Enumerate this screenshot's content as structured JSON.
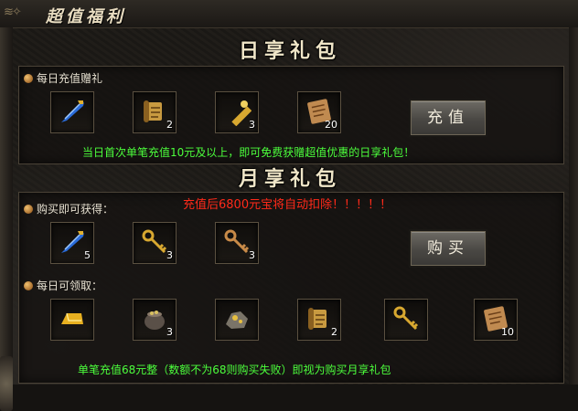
{
  "window": {
    "title": "超值福利"
  },
  "daily": {
    "title": "日享礼包",
    "subtitle": "每日充值赠礼",
    "items": [
      {
        "name": "feather-icon",
        "count": ""
      },
      {
        "name": "scroll-icon",
        "count": "2"
      },
      {
        "name": "telescope-icon",
        "count": "3"
      },
      {
        "name": "parchment-icon",
        "count": "20"
      }
    ],
    "button_label": "充值",
    "note": "当日首次单笔充值10元及以上，即可免费获赠超值优惠的日享礼包！"
  },
  "monthly": {
    "title": "月享礼包",
    "buy_label": "购买即可获得：",
    "warning": "充值后6800元宝将自动扣除！！！！！",
    "buy_items": [
      {
        "name": "feather-icon",
        "count": "5"
      },
      {
        "name": "key-icon",
        "count": "3"
      },
      {
        "name": "key-icon",
        "count": "3"
      }
    ],
    "button_label": "购买",
    "daily_label": "每日可领取：",
    "daily_items": [
      {
        "name": "gold-bar-icon",
        "count": ""
      },
      {
        "name": "pot-icon",
        "count": "3"
      },
      {
        "name": "ore-icon",
        "count": ""
      },
      {
        "name": "scroll-icon",
        "count": "2"
      },
      {
        "name": "key-icon",
        "count": ""
      },
      {
        "name": "parchment-icon",
        "count": "10"
      }
    ],
    "note": "单笔充值68元整（数额不为68则购买失败）即视为购买月享礼包"
  },
  "colors": {
    "green_text": "#4cff3c",
    "red_text": "#ff2a1a"
  }
}
